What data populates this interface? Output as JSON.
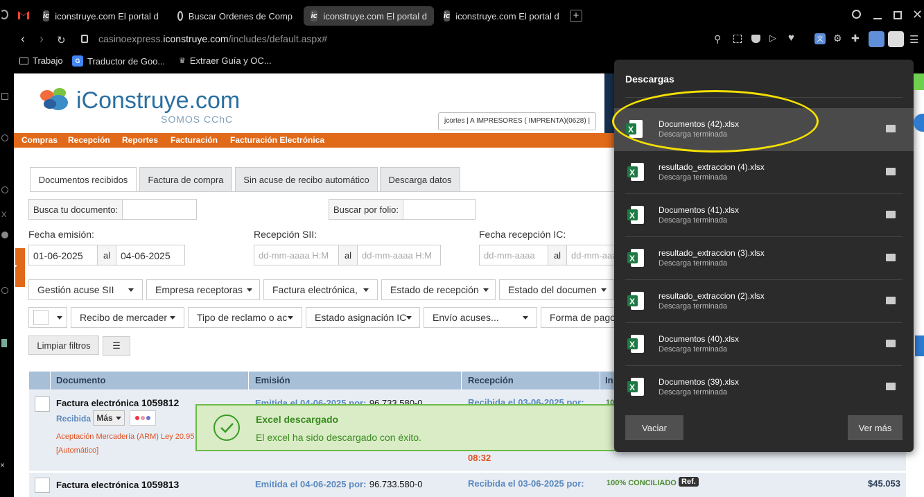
{
  "browser": {
    "tabs": [
      {
        "label": "iconstruye.com El portal d"
      },
      {
        "label": "Buscar Ordenes de Comp"
      },
      {
        "label": "iconstruye.com El portal d"
      },
      {
        "label": "iconstruye.com El portal d"
      }
    ],
    "url_prefix": "casinoexpress.",
    "url_domain": "iconstruye.com",
    "url_path": "/includes/default.aspx#",
    "bookmarks": [
      {
        "label": "Trabajo"
      },
      {
        "label": "Traductor de Goo..."
      },
      {
        "label": "Extraer Guía y OC..."
      }
    ]
  },
  "site": {
    "logo": "iConstruye.com",
    "logo_sub": "SOMOS CChC",
    "user": "jcortes | A IMPRESORES ( IMPRENTA)(0628) |",
    "menu": [
      "Compras",
      "Recepción",
      "Reportes",
      "Facturación",
      "Facturación Electrónica"
    ]
  },
  "tabs": [
    "Documentos recibidos",
    "Factura de compra",
    "Sin acuse de recibo automático",
    "Descarga datos"
  ],
  "filters": {
    "search_doc_label": "Busca tu documento:",
    "search_folio_label": "Buscar por folio:",
    "fecha_emision_label": "Fecha emisión:",
    "recepcion_sii_label": "Recepción SII:",
    "fecha_recepcion_label": "Fecha recepción IC:",
    "fecha_desde": "01-06-2025",
    "fecha_hasta": "04-06-2025",
    "al": "al",
    "placeholder_dt": "dd-mm-aaaa H:M",
    "placeholder_d": "dd-mm-aaaa",
    "dropdowns_row1": [
      "Gestión acuse SII",
      "Empresa receptoras",
      "Factura electrónica,",
      "Estado de recepción",
      "Estado del documen"
    ],
    "dropdowns_row2": [
      "Recibo de mercader",
      "Tipo de reclamo o ac",
      "Estado asignación IC",
      "Envío acuses...",
      "Forma de pago"
    ],
    "clear_button": "Limpiar filtros"
  },
  "table": {
    "headers": [
      "Documento",
      "Emisión",
      "Recepción",
      "In"
    ],
    "rows": [
      {
        "doc_type": "Factura electrónica",
        "doc_num": "1059812",
        "status": "Recibida",
        "mas": "Más",
        "arm": "Aceptación Mercadería (ARM) Ley 20.95",
        "auto": "[Automático]",
        "emision": "Emitida el 04-06-2025 por:",
        "emision_rut": "96.733.580-0",
        "recepcion": "Recibida el 03-06-2025 por:",
        "recepcion_time": "08:32",
        "info": "10"
      },
      {
        "doc_type": "Factura electrónica",
        "doc_num": "1059813",
        "emision": "Emitida el 04-06-2025 por:",
        "emision_rut": "96.733.580-0",
        "recepcion": "Recibida el 03-06-2025 por:",
        "conciliado": "100% CONCILIADO",
        "ref": "Ref.",
        "amount": "$45.053"
      }
    ]
  },
  "toast": {
    "title": "Excel descargado",
    "message": "El excel ha sido descargado con éxito."
  },
  "downloads": {
    "title": "Descargas",
    "items": [
      {
        "name": "Documentos (42).xlsx",
        "status": "Descarga terminada"
      },
      {
        "name": "resultado_extraccion (4).xlsx",
        "status": "Descarga terminada"
      },
      {
        "name": "Documentos (41).xlsx",
        "status": "Descarga terminada"
      },
      {
        "name": "resultado_extraccion (3).xlsx",
        "status": "Descarga terminada"
      },
      {
        "name": "resultado_extraccion (2).xlsx",
        "status": "Descarga terminada"
      },
      {
        "name": "Documentos (40).xlsx",
        "status": "Descarga terminada"
      },
      {
        "name": "Documentos (39).xlsx",
        "status": "Descarga terminada"
      }
    ],
    "clear_button": "Vaciar",
    "more_button": "Ver más"
  },
  "colors": {
    "highlight_circle": "#f5e000",
    "menu_orange": "#e06a1a",
    "toast_bg": "#d9ecc6",
    "toast_border": "#6cbb46"
  }
}
